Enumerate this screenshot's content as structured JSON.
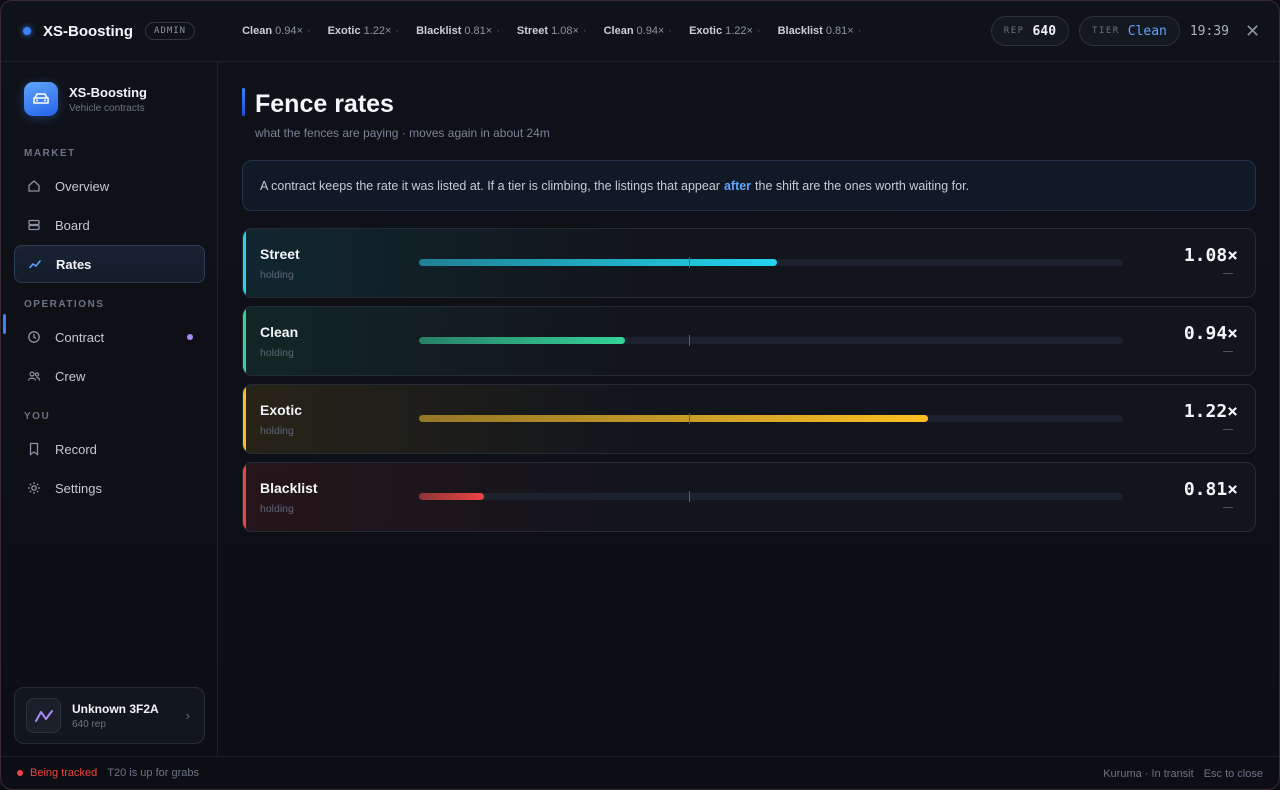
{
  "topbar": {
    "brand": "XS-Boosting",
    "badge": "ADMIN",
    "ticker": [
      {
        "name": "Clean",
        "value": "0.94×"
      },
      {
        "name": "Exotic",
        "value": "1.22×"
      },
      {
        "name": "Blacklist",
        "value": "0.81×"
      },
      {
        "name": "Street",
        "value": "1.08×"
      },
      {
        "name": "Clean",
        "value": "0.94×"
      },
      {
        "name": "Exotic",
        "value": "1.22×"
      },
      {
        "name": "Blacklist",
        "value": "0.81×"
      }
    ],
    "ticker_sep": "·",
    "rep_label": "REP",
    "rep_value": "640",
    "tier_label": "TIER",
    "tier_value": "Clean",
    "clock": "19:39",
    "close_glyph": "✕"
  },
  "sidebar": {
    "title": "XS-Boosting",
    "subtitle": "Vehicle contracts",
    "sections": {
      "market": "MARKET",
      "operations": "OPERATIONS",
      "you": "YOU"
    },
    "items": [
      {
        "label": "Overview",
        "icon": "home-icon"
      },
      {
        "label": "Board",
        "icon": "board-icon"
      },
      {
        "label": "Rates",
        "icon": "trend-icon",
        "active": true
      },
      {
        "label": "Contract",
        "icon": "clock-icon",
        "indicator": true
      },
      {
        "label": "Crew",
        "icon": "users-icon"
      },
      {
        "label": "Record",
        "icon": "bookmark-icon"
      },
      {
        "label": "Settings",
        "icon": "gear-icon"
      }
    ],
    "profile": {
      "name": "Unknown 3F2A",
      "rep": "640 rep",
      "chevron": "›"
    }
  },
  "main": {
    "title": "Fence rates",
    "subtitle": "what the fences are paying · moves again in about 24m",
    "notice_before": "A contract keeps the rate it was listed at. If a tier is climbing, the listings that appear",
    "notice_highlight": "after",
    "notice_after": "the shift are the ones worth waiting for.",
    "rates": [
      {
        "name": "Street",
        "state": "holding",
        "multiplier": "1.08×",
        "fill_fraction": 0.508,
        "color": "#22d3ee"
      },
      {
        "name": "Clean",
        "state": "holding",
        "multiplier": "0.94×",
        "fill_fraction": 0.293,
        "color": "#34d399"
      },
      {
        "name": "Exotic",
        "state": "holding",
        "multiplier": "1.22×",
        "fill_fraction": 0.723,
        "color": "#fbbf24"
      },
      {
        "name": "Blacklist",
        "state": "holding",
        "multiplier": "0.81×",
        "fill_fraction": 0.092,
        "color": "#ef4444"
      }
    ]
  },
  "statusbar": {
    "tracked": "Being tracked",
    "message": "T20 is up for grabs",
    "vehicle": "Kuruma · In transit",
    "esc": "Esc to close"
  },
  "colors": {
    "accent": "#3b82f6",
    "danger": "#ef4444",
    "crew_dot": "#a78bfa"
  }
}
